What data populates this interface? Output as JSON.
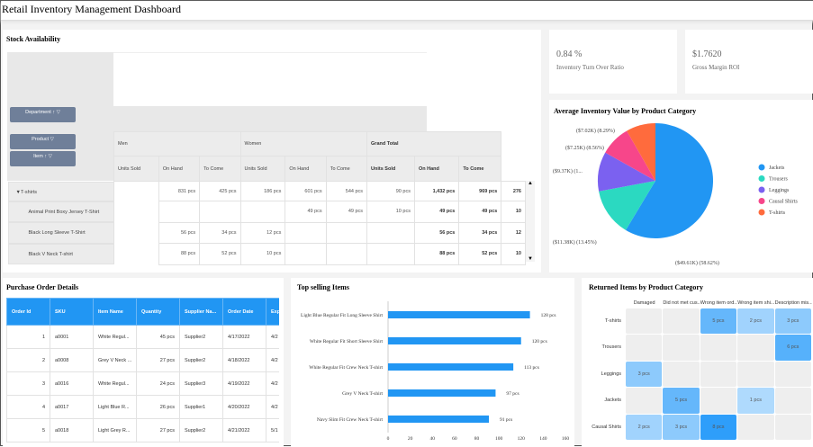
{
  "app": {
    "title": "Retail Inventory Management Dashboard"
  },
  "stock": {
    "title": "Stock Availability",
    "buttons": {
      "department": "Department",
      "product": "Product",
      "item": "Item"
    },
    "groups": [
      "Men",
      "Women",
      "Grand Total"
    ],
    "measures": [
      "Units Sold",
      "On Hand",
      "To Come"
    ],
    "rows": [
      {
        "label": "▼T-shirts",
        "cells": [
          "831 pcs",
          "425 pcs",
          "186 pcs",
          "601 pcs",
          "544 pcs",
          "90 pcs",
          "1,432 pcs",
          "969 pcs",
          "276"
        ]
      },
      {
        "label": "Animal Print Boxy Jersey T-Shirt",
        "cells": [
          "",
          "",
          "",
          "49 pcs",
          "49 pcs",
          "10 pcs",
          "49 pcs",
          "49 pcs",
          "10"
        ]
      },
      {
        "label": "Black Long Sleeve T-Shirt",
        "cells": [
          "56 pcs",
          "34 pcs",
          "12 pcs",
          "",
          "",
          "",
          "56 pcs",
          "34 pcs",
          "12"
        ]
      },
      {
        "label": "Black V Neck T-shirt",
        "cells": [
          "88 pcs",
          "52 pcs",
          "10 pcs",
          "",
          "",
          "",
          "88 pcs",
          "52 pcs",
          "10"
        ]
      }
    ]
  },
  "kpis": [
    {
      "value": "0.84 %",
      "label": "Inventory Turn Over Ratio"
    },
    {
      "value": "$1.7620",
      "label": "Gross Margin ROI"
    }
  ],
  "pie": {
    "title": "Average Inventory Value by Product Category",
    "chart_data": {
      "type": "pie",
      "slices": [
        {
          "name": "Jackets",
          "value": 58.62,
          "label": "($49.61K) (58.62%)",
          "color": "#2196f3"
        },
        {
          "name": "Trousers",
          "value": 13.45,
          "label": "($11.38K) (13.45%)",
          "color": "#2bd9c1"
        },
        {
          "name": "Leggings",
          "value": 11.08,
          "label": "($9.37K) (1...",
          "color": "#7b61f0"
        },
        {
          "name": "Causal Shirts",
          "value": 8.56,
          "label": "($7.25K) (8.56%)",
          "color": "#f7468a"
        },
        {
          "name": "T-shirts",
          "value": 8.29,
          "label": "($7.02K) (8.29%)",
          "color": "#ff6b3d"
        }
      ],
      "legend": "right"
    }
  },
  "po": {
    "title": "Purchase Order Details",
    "columns": [
      "Order Id",
      "SKU",
      "Item Name",
      "Quantity",
      "Supplier Na...",
      "Order Date",
      "Exp"
    ],
    "rows": [
      [
        "1",
        "a0001",
        "White Regul...",
        "45 pcs",
        "Supplier2",
        "4/17/2022",
        "4/2"
      ],
      [
        "2",
        "a0008",
        "Grey V Neck ...",
        "27 pcs",
        "Supplier2",
        "4/18/2022",
        "4/2"
      ],
      [
        "3",
        "a0016",
        "White Regul...",
        "24 pcs",
        "Supplier3",
        "4/19/2022",
        "4/2"
      ],
      [
        "4",
        "a0017",
        "Light Blue R...",
        "26 pcs",
        "Supplier1",
        "4/20/2022",
        "4/2"
      ],
      [
        "5",
        "a0018",
        "Light Grey R...",
        "27 pcs",
        "Supplier2",
        "4/21/2022",
        "5/1"
      ]
    ]
  },
  "top": {
    "title": "Top selling Items",
    "chart_data": {
      "type": "bar",
      "orientation": "horizontal",
      "categories": [
        "Light Blue Regular Fit Long Sleeve Shirt",
        "White Regular Fit Short Sleeve Shirt",
        "White Regular Fit Crew Neck T-shirt",
        "Grey V Neck T-shirt",
        "Navy Slim Fit Crew Neck T-shirt"
      ],
      "values": [
        128,
        120,
        113,
        97,
        91
      ],
      "labels": [
        "128 pcs",
        "120 pcs",
        "113 pcs",
        "97 pcs",
        "91 pcs"
      ],
      "xlim": [
        0,
        160
      ],
      "xticks": [
        "0",
        "20",
        "40",
        "60",
        "80",
        "100",
        "120",
        "140",
        "160"
      ],
      "color": "#2196f3"
    }
  },
  "returns": {
    "title": "Returned Items by Product Category",
    "chart_data": {
      "type": "heatmap",
      "columns": [
        "Damaged",
        "Did not met cus...",
        "Wrong item ord...",
        "Wrong item shi...",
        "Description mis..."
      ],
      "rows": [
        "T-shirts",
        "Trousers",
        "Leggings",
        "Jackets",
        "Causal Shirts"
      ],
      "values": [
        [
          null,
          null,
          5,
          2,
          3
        ],
        [
          null,
          null,
          null,
          null,
          6
        ],
        [
          3,
          null,
          null,
          null,
          null
        ],
        [
          null,
          5,
          null,
          1,
          null
        ],
        [
          2,
          3,
          8,
          null,
          null
        ]
      ],
      "unit": "pcs"
    }
  }
}
